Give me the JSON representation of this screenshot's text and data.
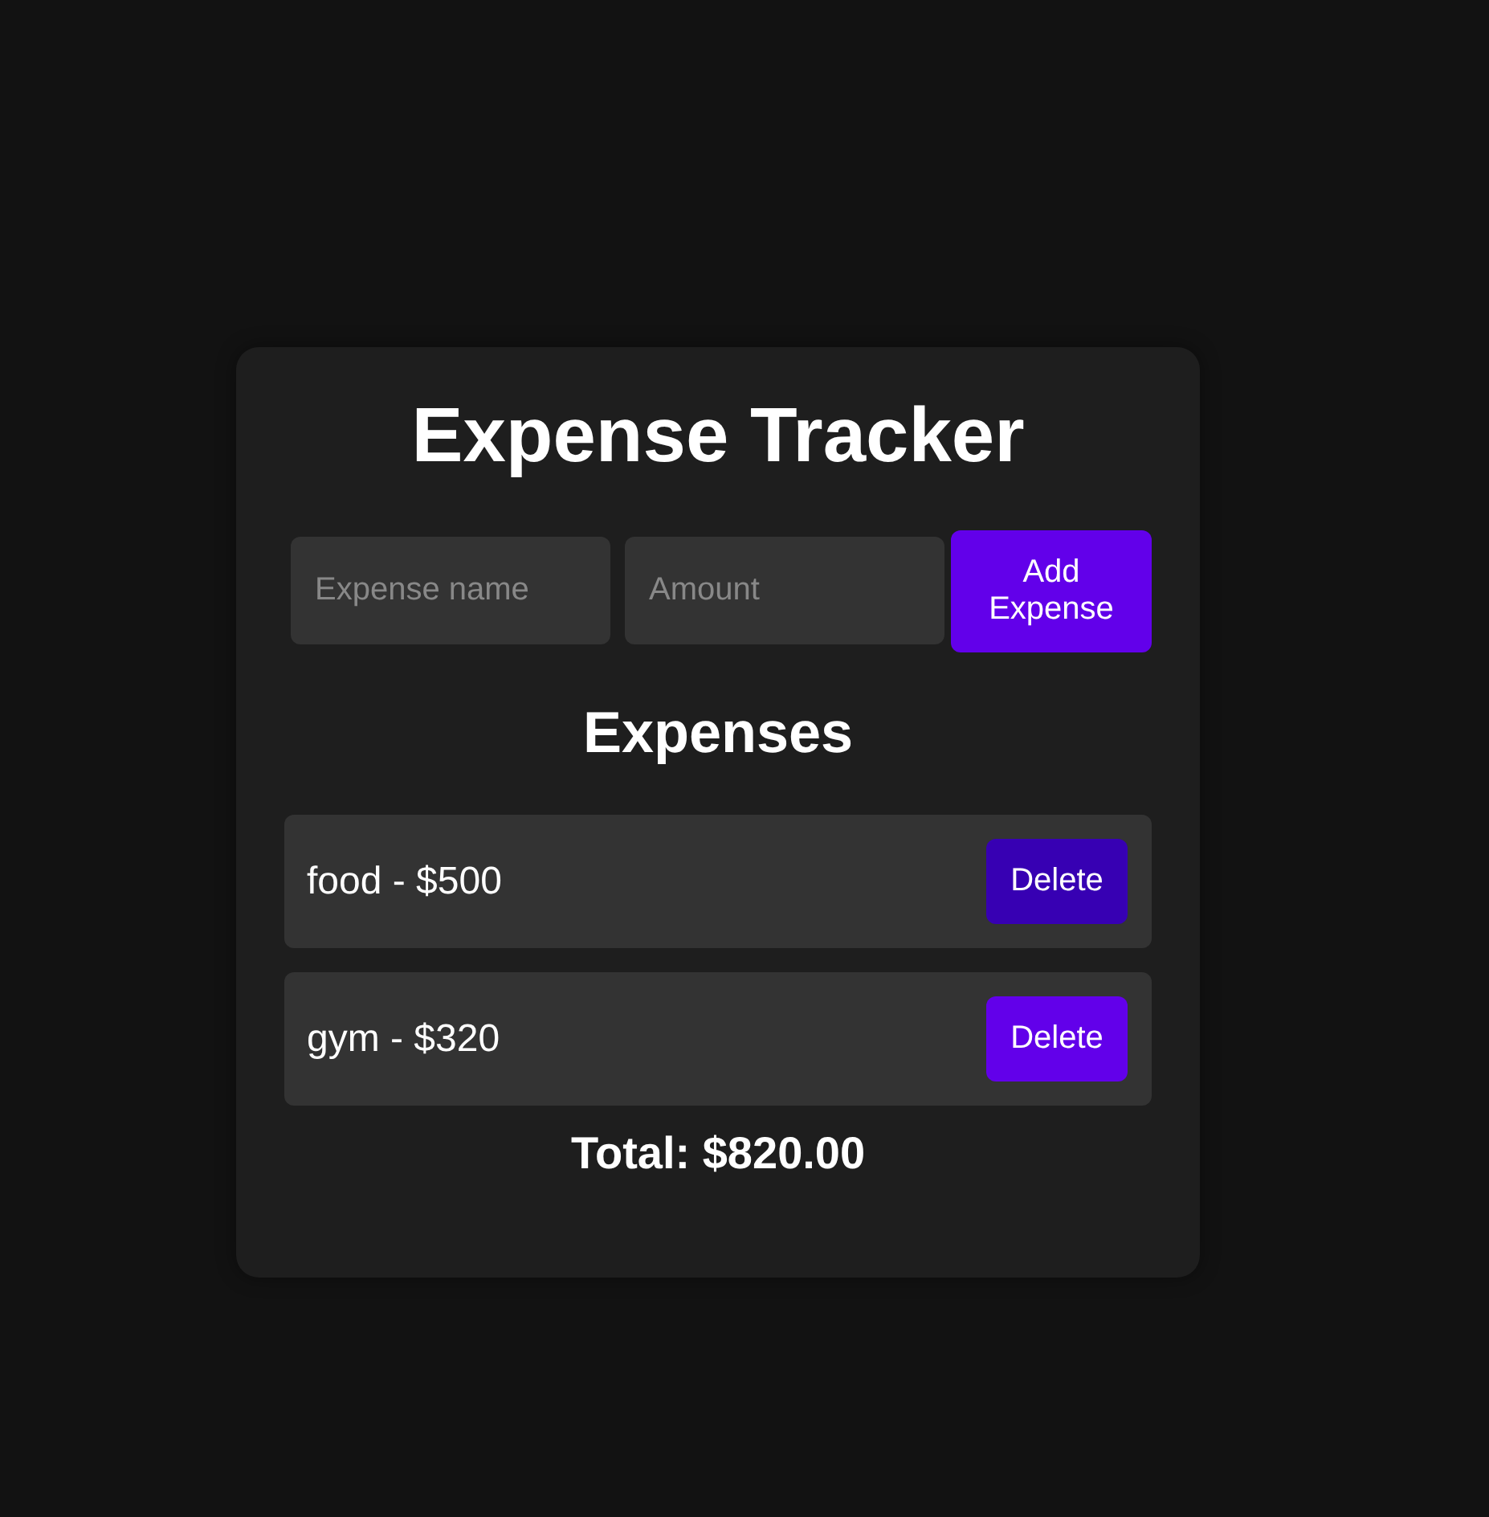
{
  "app": {
    "title": "Expense Tracker"
  },
  "form": {
    "fields": [
      {
        "placeholder": "Expense name"
      },
      {
        "placeholder": "Amount"
      }
    ],
    "add_button": "Add Expense"
  },
  "list": {
    "heading": "Expenses",
    "items": [
      {
        "text": "food - $500",
        "delete_button": "Delete",
        "delete_hovered": true
      },
      {
        "text": "gym - $320",
        "delete_button": "Delete",
        "delete_hovered": false
      }
    ]
  },
  "total": "Total: $820.00"
}
